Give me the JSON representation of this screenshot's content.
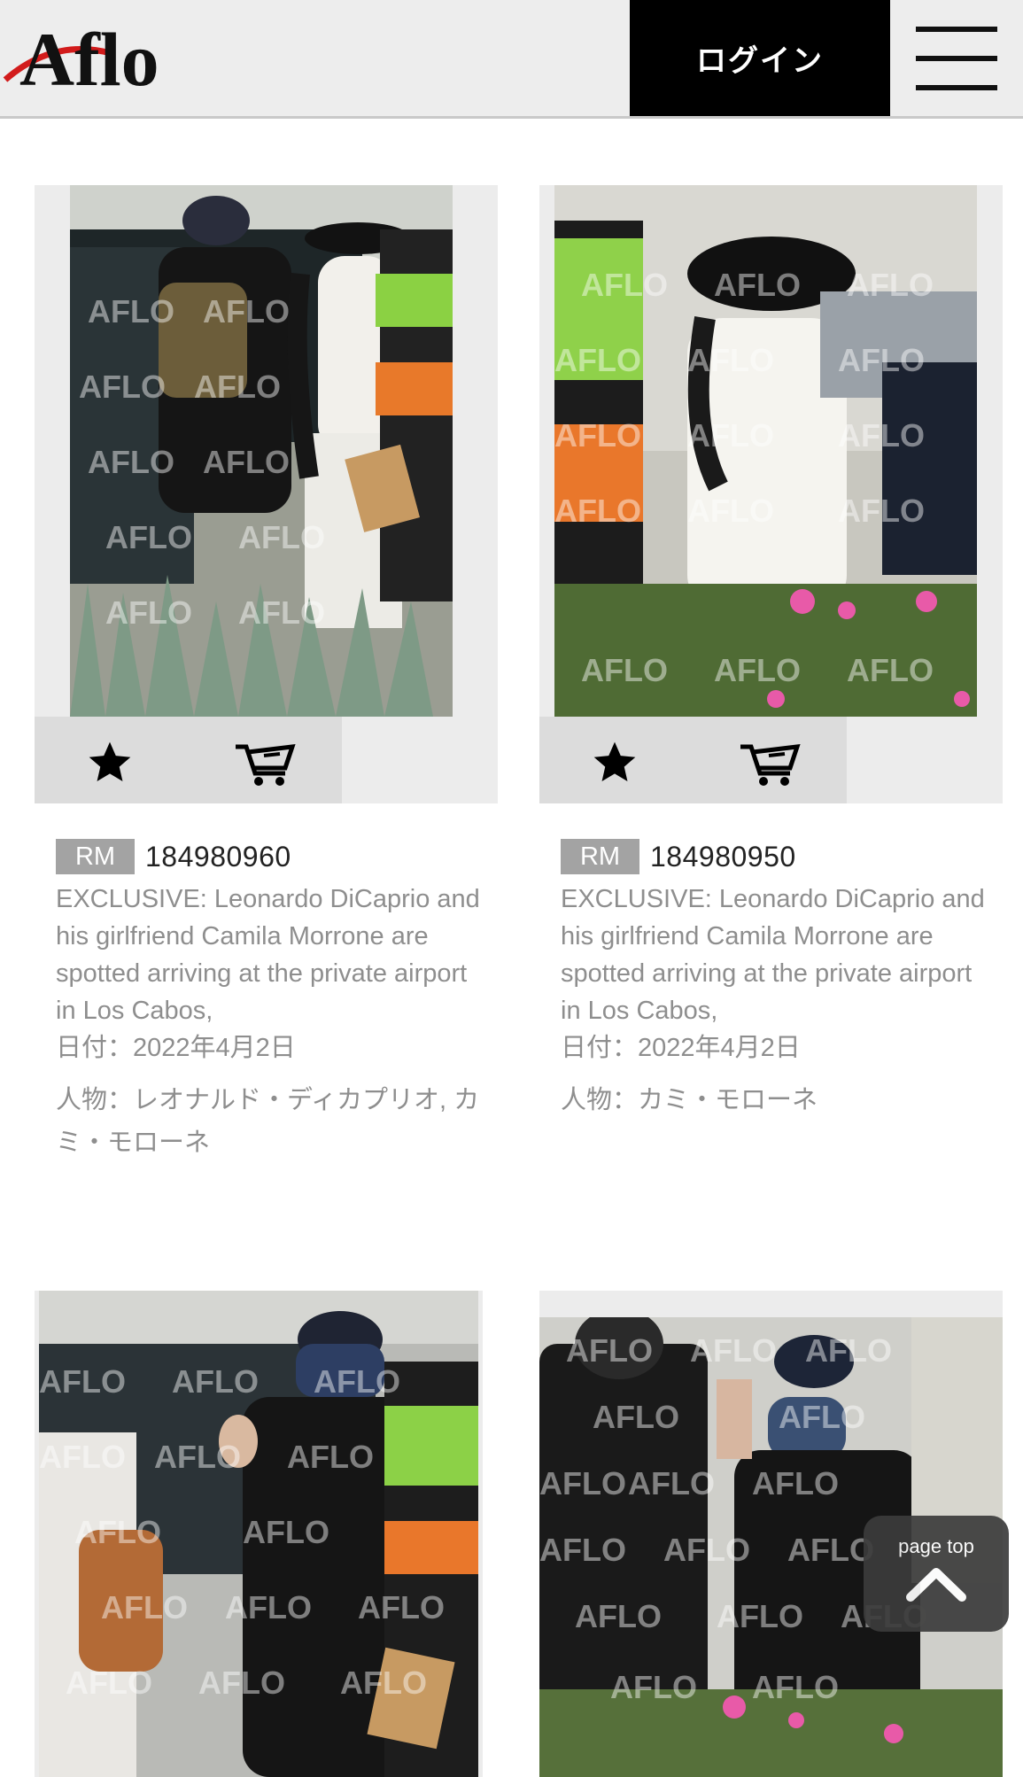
{
  "header": {
    "logo_text": "Aflo",
    "login_label": "ログイン",
    "menu_icon": "hamburger-menu-icon"
  },
  "cards": [
    {
      "badge": "RM",
      "id": "184980960",
      "caption": "EXCLUSIVE: Leonardo DiCaprio and his girlfriend Camila Morrone are spotted arriving at the private airport in Los Cabos,",
      "date": "日付：2022年4月2日",
      "people": "人物：レオナルド・ディカプリオ, カミ・モローネ"
    },
    {
      "badge": "RM",
      "id": "184980950",
      "caption": "EXCLUSIVE: Leonardo DiCaprio and his girlfriend Camila Morrone are spotted arriving at the private airport in Los Cabos,",
      "date": "日付：2022年4月2日",
      "people": "人物：カミ・モローネ"
    }
  ],
  "watermark": "AFLO",
  "icons": {
    "favorite": "star-icon",
    "cart": "cart-icon",
    "page_top": "chevron-up-icon"
  },
  "page_top_label": "page top"
}
